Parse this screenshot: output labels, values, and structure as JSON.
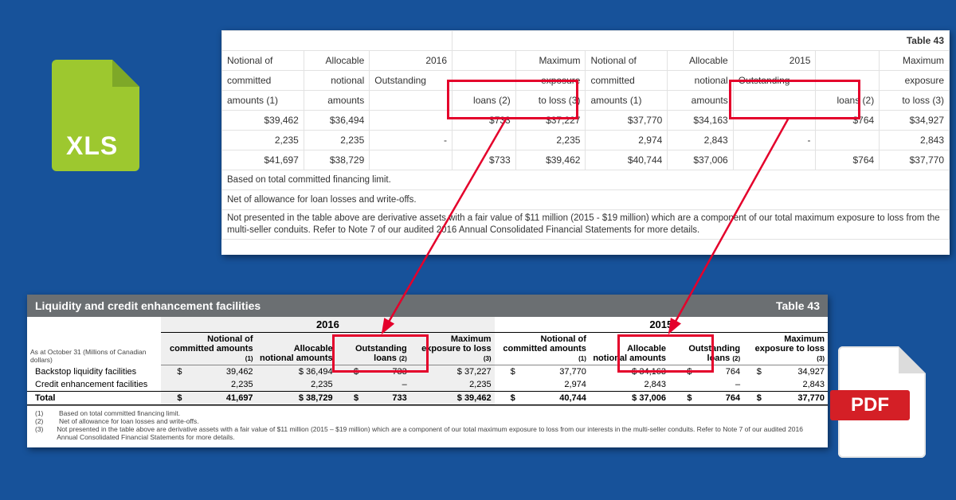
{
  "icons": {
    "xls_label": "XLS",
    "pdf_label": "PDF"
  },
  "top": {
    "table_no": "Table 43",
    "years": {
      "y1": "2016",
      "y2": "2015"
    },
    "hdr": {
      "a1": "Notional of",
      "a2": "committed",
      "a3": "amounts (1)",
      "b1": "Allocable",
      "b2": "notional",
      "b3": "amounts",
      "c1": "Outstanding",
      "c2": "loans (2)",
      "d1": "Maximum",
      "d2": "exposure",
      "d3": "to loss (3)"
    },
    "rows": [
      {
        "c": [
          "$39,462",
          "$36,494",
          "",
          "$733",
          "$37,227",
          "$37,770",
          "$34,163",
          "",
          "$764",
          "$34,927"
        ]
      },
      {
        "c": [
          "2,235",
          "2,235",
          "-",
          "",
          "2,235",
          "2,974",
          "2,843",
          "-",
          "",
          "2,843"
        ]
      },
      {
        "c": [
          "$41,697",
          "$38,729",
          "",
          "$733",
          "$39,462",
          "$40,744",
          "$37,006",
          "",
          "$764",
          "$37,770"
        ]
      }
    ],
    "notes": [
      "Based on total committed financing limit.",
      "Net of allowance for loan losses and write-offs.",
      "Not presented in the table above are derivative assets with a fair value of $11 million (2015 - $19 million) which are a component of our total maximum exposure to loss from the multi-seller conduits. Refer to Note 7 of our audited 2016 Annual Consolidated Financial Statements for more details."
    ]
  },
  "pdf": {
    "title": "Liquidity and credit enhancement facilities",
    "table_no": "Table 43",
    "meta": "As at October 31 (Millions of Canadian dollars)",
    "years": {
      "y1": "2016",
      "y2": "2015"
    },
    "cols": {
      "a": "Notional of committed amounts",
      "b": "Allocable notional amounts",
      "c": "Outstanding loans",
      "d": "Maximum exposure to loss"
    },
    "sup": {
      "a": "(1)",
      "c": "(2)",
      "d": "(3)"
    },
    "rows": [
      {
        "label": "Backstop liquidity facilities",
        "y16": [
          "$",
          "39,462",
          "$ 36,494",
          "$",
          "733",
          "$ 37,227"
        ],
        "y15": [
          "$",
          "37,770",
          "$ 34,163",
          "$",
          "764",
          "$",
          "34,927"
        ]
      },
      {
        "label": "Credit enhancement facilities",
        "y16": [
          "",
          "2,235",
          "2,235",
          "",
          "–",
          "2,235"
        ],
        "y15": [
          "",
          "2,974",
          "2,843",
          "",
          "–",
          "",
          "2,843"
        ]
      }
    ],
    "total": {
      "label": "Total",
      "y16": [
        "$",
        "41,697",
        "$ 38,729",
        "$",
        "733",
        "$ 39,462"
      ],
      "y15": [
        "$",
        "40,744",
        "$ 37,006",
        "$",
        "764",
        "$",
        "37,770"
      ]
    },
    "footnotes": [
      {
        "n": "(1)",
        "t": "Based on total committed financing limit."
      },
      {
        "n": "(2)",
        "t": "Net of allowance for loan losses and write-offs."
      },
      {
        "n": "(3)",
        "t": "Not presented in the table above are derivative assets with a fair value of $11 million (2015 – $19 million) which are a component of our total maximum exposure to loss from our interests in the multi-seller conduits. Refer to Note 7 of our audited 2016 Annual Consolidated Financial Statements for more details."
      }
    ]
  },
  "chart_data": {
    "type": "table",
    "title": "Liquidity and credit enhancement facilities — Table 43",
    "unit": "Millions of Canadian dollars, as at October 31",
    "columns": [
      "Notional of committed amounts",
      "Allocable notional amounts",
      "Outstanding loans",
      "Maximum exposure to loss"
    ],
    "series": [
      {
        "year": 2016,
        "rows": {
          "Backstop liquidity facilities": [
            39462,
            36494,
            733,
            37227
          ],
          "Credit enhancement facilities": [
            2235,
            2235,
            null,
            2235
          ],
          "Total": [
            41697,
            38729,
            733,
            39462
          ]
        }
      },
      {
        "year": 2015,
        "rows": {
          "Backstop liquidity facilities": [
            37770,
            34163,
            764,
            34927
          ],
          "Credit enhancement facilities": [
            2974,
            2843,
            null,
            2843
          ],
          "Total": [
            40744,
            37006,
            764,
            37770
          ]
        }
      }
    ]
  }
}
